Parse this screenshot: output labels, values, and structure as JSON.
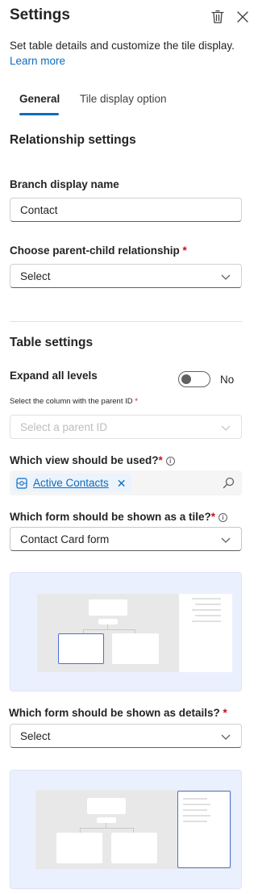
{
  "header": {
    "title": "Settings",
    "description": "Set table details and customize the tile display.",
    "learn_more": "Learn more"
  },
  "tabs": [
    {
      "label": "General",
      "active": true
    },
    {
      "label": "Tile display option",
      "active": false
    }
  ],
  "relationship": {
    "section_title": "Relationship settings",
    "branch_label": "Branch display name",
    "branch_value": "Contact",
    "parent_child_label": "Choose parent-child relationship",
    "parent_child_value": "Select",
    "required_mark": "*"
  },
  "table": {
    "section_title": "Table settings",
    "expand_label": "Expand all levels",
    "expand_state": "No",
    "parent_id_label": "Select the column with the parent ID",
    "parent_id_placeholder": "Select a parent ID",
    "view_label": "Which view should be used?",
    "view_tag": "Active Contacts",
    "tile_form_label": "Which form should be shown as a tile?",
    "tile_form_value": "Contact Card form",
    "details_form_label": "Which form should be shown as details?",
    "details_form_value": "Select"
  },
  "icons": {
    "delete": "trash-icon",
    "close": "close-icon",
    "search": "search-icon",
    "info": "info-icon",
    "chevron": "chevron-down-icon",
    "view": "view-icon"
  },
  "colors": {
    "accent": "#0f6cbd",
    "required": "#c50f1f",
    "preview_bg": "#ebf0fe",
    "selection": "#4a6fd8"
  }
}
